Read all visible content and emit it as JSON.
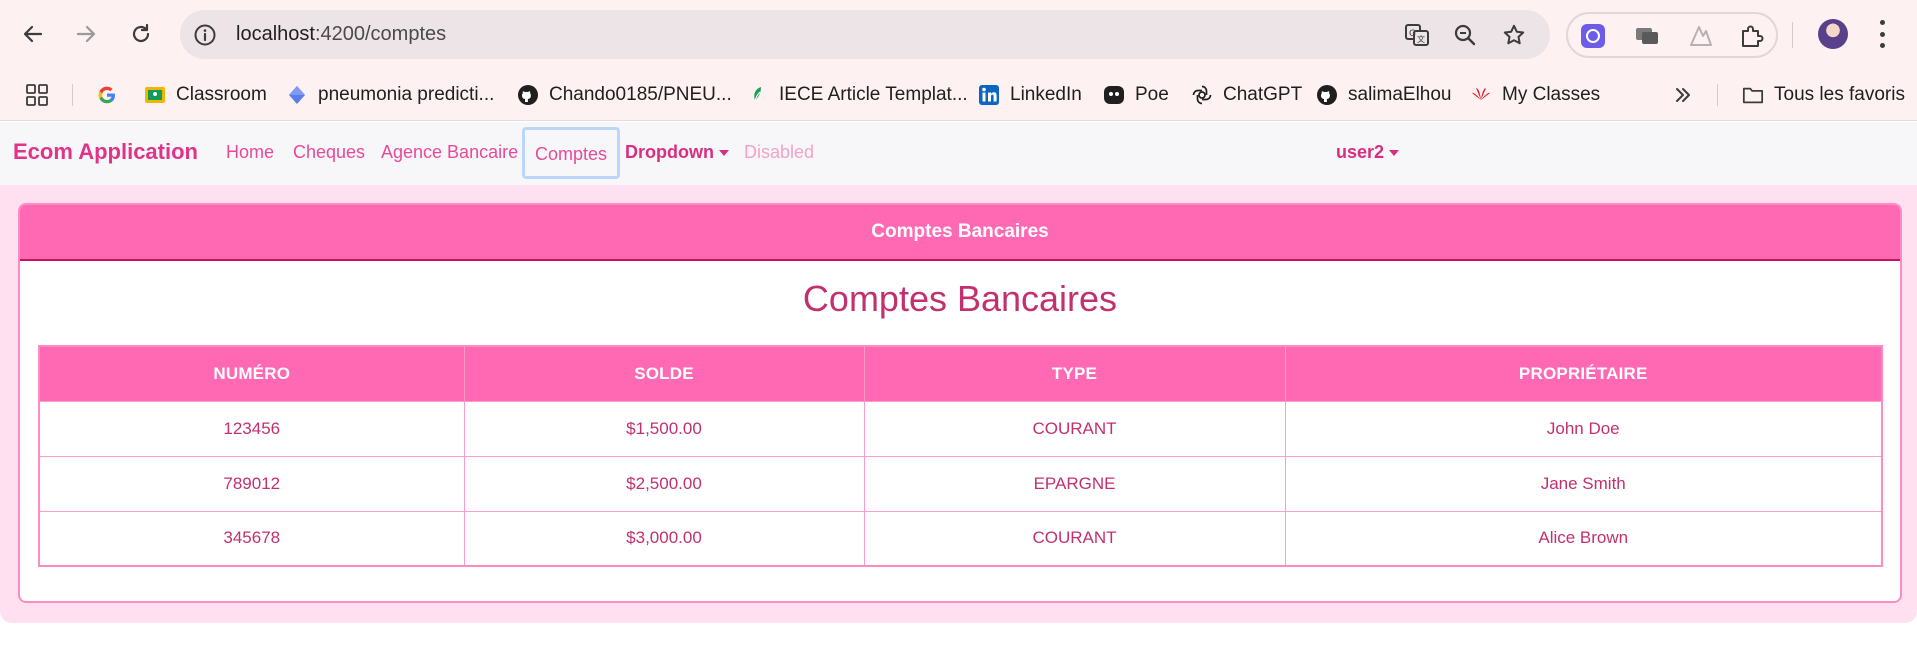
{
  "browser": {
    "url_host": "localhost",
    "url_path": ":4200/comptes",
    "bookmarks": [
      {
        "label": "",
        "icon": "apps-grid-icon"
      },
      {
        "label": "",
        "icon": "google-icon"
      },
      {
        "label": "Classroom",
        "icon": "classroom-icon"
      },
      {
        "label": "pneumonia predicti...",
        "icon": "diamond-icon"
      },
      {
        "label": "Chando0185/PNEU...",
        "icon": "github-icon"
      },
      {
        "label": "IECE Article Templat...",
        "icon": "leaf-icon"
      },
      {
        "label": "LinkedIn",
        "icon": "linkedin-icon"
      },
      {
        "label": "Poe",
        "icon": "poe-icon"
      },
      {
        "label": "ChatGPT",
        "icon": "chatgpt-icon"
      },
      {
        "label": "salimaElhou",
        "icon": "github-icon"
      },
      {
        "label": "My Classes",
        "icon": "huawei-icon"
      }
    ],
    "all_bookmarks_label": "Tous les favoris"
  },
  "navbar": {
    "brand": "Ecom Application",
    "links": [
      "Home",
      "Cheques",
      "Agence Bancaire",
      "Comptes",
      "Dropdown",
      "Disabled"
    ],
    "user": "user2"
  },
  "card": {
    "header": "Comptes Bancaires",
    "title": "Comptes Bancaires"
  },
  "table": {
    "columns": [
      "NUMÉRO",
      "SOLDE",
      "TYPE",
      "PROPRIÉTAIRE"
    ],
    "rows": [
      [
        "123456",
        "$1,500.00",
        "COURANT",
        "John Doe"
      ],
      [
        "789012",
        "$2,500.00",
        "EPARGNE",
        "Jane Smith"
      ],
      [
        "345678",
        "$3,000.00",
        "COURANT",
        "Alice Brown"
      ]
    ]
  },
  "colors": {
    "accent": "#ff69b4",
    "brand": "#e0338a",
    "text": "#c2306f",
    "page_bg": "#ffe0f0"
  }
}
